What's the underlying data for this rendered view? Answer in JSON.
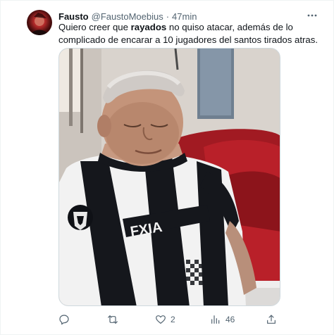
{
  "tweet": {
    "author_name": "Fausto",
    "author_handle": "@FaustoMoebius",
    "separator": "·",
    "time": "47min",
    "text_before": "Quiero creer que ",
    "text_bold": "rayados",
    "text_after": " no quiso atacar, además de lo complicado de encarar a 10 jugadores del santos tirados atras."
  },
  "actions": {
    "reply_count": "",
    "retweet_count": "",
    "like_count": "2",
    "views_count": "46"
  },
  "colors": {
    "text_primary": "#0f1419",
    "text_secondary": "#536471",
    "border": "#cfd9de"
  },
  "icons": {
    "more": "more-dots-icon",
    "reply": "reply-icon",
    "retweet": "retweet-icon",
    "like": "heart-icon",
    "views": "views-icon",
    "share": "share-icon"
  }
}
